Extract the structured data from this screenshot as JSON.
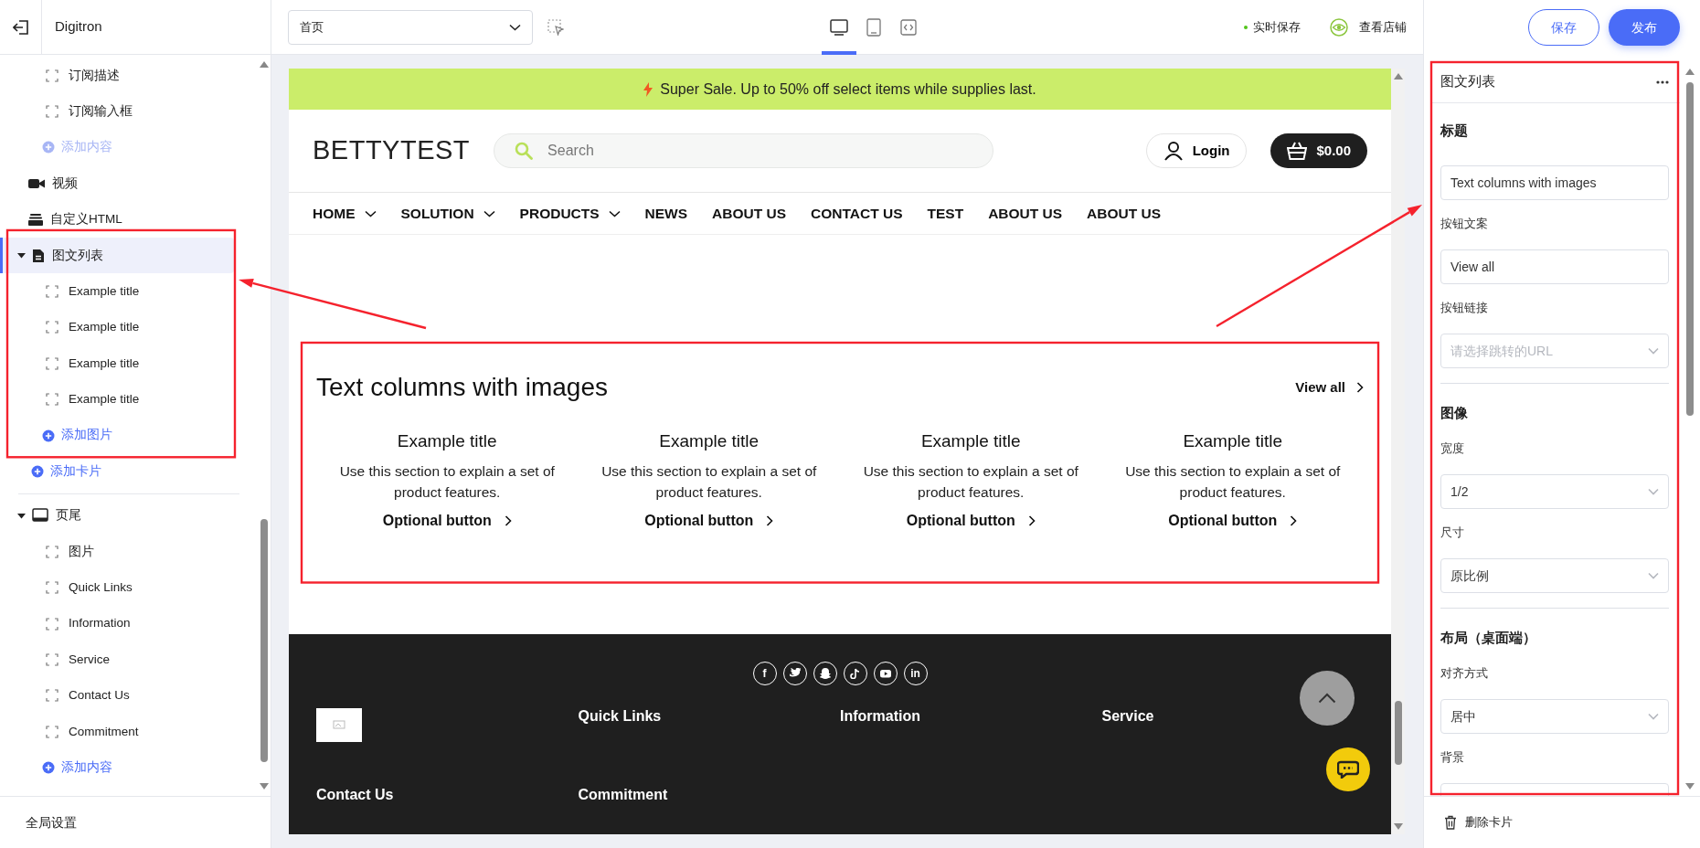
{
  "app": {
    "name": "Digitron"
  },
  "outline": {
    "items": [
      {
        "kind": "group",
        "children": [
          {
            "kind": "block",
            "label": "订阅描述"
          },
          {
            "kind": "block",
            "label": "订阅输入框"
          },
          {
            "kind": "add",
            "label": "添加内容",
            "disabled": true
          }
        ]
      },
      {
        "kind": "video",
        "label": "视频",
        "selected": false
      },
      {
        "kind": "html",
        "label": "自定义HTML",
        "selected": false
      },
      {
        "kind": "imagetext",
        "label": "图文列表",
        "selected": true,
        "expanded": true,
        "annotated": true,
        "children": [
          {
            "kind": "block",
            "label": "Example title"
          },
          {
            "kind": "block",
            "label": "Example title"
          },
          {
            "kind": "block",
            "label": "Example title"
          },
          {
            "kind": "block",
            "label": "Example title"
          },
          {
            "kind": "add",
            "label": "添加图片",
            "disabled": false
          }
        ]
      },
      {
        "kind": "add",
        "label": "添加卡片",
        "disabled": false
      },
      {
        "kind": "divider"
      },
      {
        "kind": "footer",
        "label": "页尾",
        "selected": false,
        "expanded": true,
        "children": [
          {
            "kind": "block",
            "label": "图片"
          },
          {
            "kind": "block",
            "label": "Quick Links"
          },
          {
            "kind": "block",
            "label": "Information"
          },
          {
            "kind": "block",
            "label": "Service"
          },
          {
            "kind": "block",
            "label": "Contact Us"
          },
          {
            "kind": "block",
            "label": "Commitment"
          },
          {
            "kind": "add",
            "label": "添加内容",
            "disabled": false
          }
        ]
      }
    ],
    "settings": "全局设置"
  },
  "toolbar": {
    "page_select": {
      "value": "首页"
    },
    "devices": [
      {
        "kind": "desktop",
        "selected": true
      },
      {
        "kind": "tablet",
        "selected": false
      },
      {
        "kind": "code",
        "selected": false
      }
    ],
    "autosave": "实时保存",
    "view_store": "查看店铺",
    "buttons": [
      {
        "kind": "outline",
        "label": "保存"
      },
      {
        "kind": "primary",
        "label": "发布"
      }
    ]
  },
  "preview": {
    "announcement": "Super Sale. Up to 50% off select items while supplies last.",
    "logo": "BETTYTEST",
    "search": {
      "placeholder": "Search"
    },
    "login": "Login",
    "cart": "$0.00",
    "nav": [
      {
        "label": "HOME",
        "dropdown": true
      },
      {
        "label": "SOLUTION",
        "dropdown": true
      },
      {
        "label": "PRODUCTS",
        "dropdown": true
      },
      {
        "label": "NEWS",
        "dropdown": false
      },
      {
        "label": "ABOUT US",
        "dropdown": false
      },
      {
        "label": "CONTACT US",
        "dropdown": false
      },
      {
        "label": "TEST",
        "dropdown": false
      },
      {
        "label": "ABOUT US",
        "dropdown": false
      },
      {
        "label": "ABOUT US",
        "dropdown": false
      }
    ],
    "section": {
      "annotated": true,
      "title": "Text columns with images",
      "view_all": "View all",
      "columns": [
        {
          "title": "Example title",
          "text": "Use this section to explain a set of product features.",
          "button": "Optional button"
        },
        {
          "title": "Example title",
          "text": "Use this section to explain a set of product features.",
          "button": "Optional button"
        },
        {
          "title": "Example title",
          "text": "Use this section to explain a set of product features.",
          "button": "Optional button"
        },
        {
          "title": "Example title",
          "text": "Use this section to explain a set of product features.",
          "button": "Optional button"
        }
      ]
    },
    "footer": {
      "socials": [
        {
          "kind": "facebook",
          "label": "f"
        },
        {
          "kind": "twitter"
        },
        {
          "kind": "snapchat"
        },
        {
          "kind": "tiktok"
        },
        {
          "kind": "youtube"
        },
        {
          "kind": "linkedin",
          "label": "in"
        }
      ],
      "columns": [
        "Quick Links",
        "Information",
        "Service",
        "Contact Us",
        "Commitment"
      ]
    }
  },
  "inspector": {
    "title": "图文列表",
    "annotated": true,
    "rows": [
      {
        "kind": "heading",
        "text": "标题"
      },
      {
        "kind": "input",
        "value": "Text columns with images"
      },
      {
        "kind": "label",
        "text": "按钮文案"
      },
      {
        "kind": "input",
        "value": "View all"
      },
      {
        "kind": "label",
        "text": "按钮链接"
      },
      {
        "kind": "select",
        "placeholder": "请选择跳转的URL"
      },
      {
        "kind": "divider"
      },
      {
        "kind": "heading",
        "text": "图像"
      },
      {
        "kind": "label",
        "text": "宽度"
      },
      {
        "kind": "select",
        "value": "1/2"
      },
      {
        "kind": "label",
        "text": "尺寸"
      },
      {
        "kind": "select",
        "value": "原比例"
      },
      {
        "kind": "divider"
      },
      {
        "kind": "heading",
        "text": "布局（桌面端）"
      },
      {
        "kind": "label",
        "text": "对齐方式"
      },
      {
        "kind": "select",
        "value": "居中"
      },
      {
        "kind": "label",
        "text": "背景"
      },
      {
        "kind": "select"
      }
    ],
    "delete": "删除卡片"
  }
}
